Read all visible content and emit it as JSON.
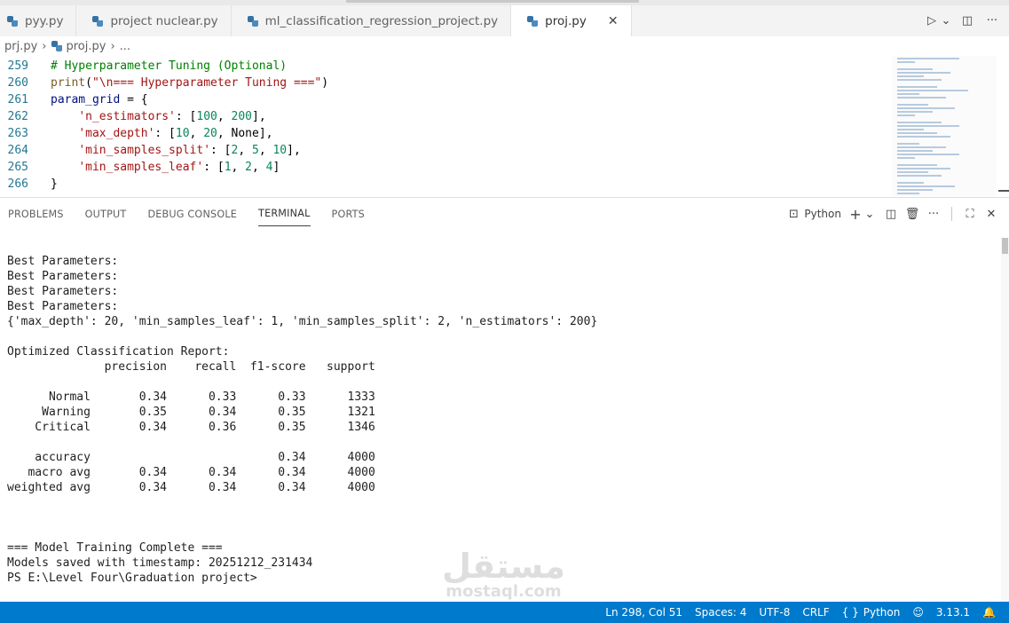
{
  "tabs": [
    {
      "label": "pyy.py",
      "active": false
    },
    {
      "label": "project nuclear.py",
      "active": false
    },
    {
      "label": "ml_classification_regression_project.py",
      "active": false
    },
    {
      "label": "proj.py",
      "active": true
    }
  ],
  "tab_close_glyph": "✕",
  "tab_actions": {
    "run": "▷",
    "run_dropdown": "⌄",
    "split": "◫",
    "more": "···"
  },
  "breadcrumb": {
    "folder": "prj.py",
    "file": "proj.py",
    "more": "..."
  },
  "editor": {
    "lines": [
      {
        "num": "259",
        "tokens": [
          {
            "t": "# Hyperparameter Tuning (Optional)",
            "c": "c-com"
          }
        ]
      },
      {
        "num": "260",
        "tokens": [
          {
            "t": "print",
            "c": "c-fn"
          },
          {
            "t": "(",
            "c": ""
          },
          {
            "t": "\"\\n=== Hyperparameter Tuning ===\"",
            "c": "c-str"
          },
          {
            "t": ")",
            "c": ""
          }
        ]
      },
      {
        "num": "261",
        "tokens": [
          {
            "t": "param_grid",
            "c": "c-var"
          },
          {
            "t": " = {",
            "c": ""
          }
        ]
      },
      {
        "num": "262",
        "tokens": [
          {
            "t": "    ",
            "c": ""
          },
          {
            "t": "'n_estimators'",
            "c": "c-str"
          },
          {
            "t": ": [",
            "c": ""
          },
          {
            "t": "100",
            "c": "c-num"
          },
          {
            "t": ", ",
            "c": ""
          },
          {
            "t": "200",
            "c": "c-num"
          },
          {
            "t": "],",
            "c": ""
          }
        ]
      },
      {
        "num": "263",
        "tokens": [
          {
            "t": "    ",
            "c": ""
          },
          {
            "t": "'max_depth'",
            "c": "c-str"
          },
          {
            "t": ": [",
            "c": ""
          },
          {
            "t": "10",
            "c": "c-num"
          },
          {
            "t": ", ",
            "c": ""
          },
          {
            "t": "20",
            "c": "c-num"
          },
          {
            "t": ", None],",
            "c": ""
          }
        ]
      },
      {
        "num": "264",
        "tokens": [
          {
            "t": "    ",
            "c": ""
          },
          {
            "t": "'min_samples_split'",
            "c": "c-str"
          },
          {
            "t": ": [",
            "c": ""
          },
          {
            "t": "2",
            "c": "c-num"
          },
          {
            "t": ", ",
            "c": ""
          },
          {
            "t": "5",
            "c": "c-num"
          },
          {
            "t": ", ",
            "c": ""
          },
          {
            "t": "10",
            "c": "c-num"
          },
          {
            "t": "],",
            "c": ""
          }
        ]
      },
      {
        "num": "265",
        "tokens": [
          {
            "t": "    ",
            "c": ""
          },
          {
            "t": "'min_samples_leaf'",
            "c": "c-str"
          },
          {
            "t": ": [",
            "c": ""
          },
          {
            "t": "1",
            "c": "c-num"
          },
          {
            "t": ", ",
            "c": ""
          },
          {
            "t": "2",
            "c": "c-num"
          },
          {
            "t": ", ",
            "c": ""
          },
          {
            "t": "4",
            "c": "c-num"
          },
          {
            "t": "]",
            "c": ""
          }
        ]
      },
      {
        "num": "266",
        "tokens": [
          {
            "t": "}",
            "c": ""
          }
        ]
      }
    ]
  },
  "panel": {
    "tabs": [
      {
        "label": "PROBLEMS",
        "active": false
      },
      {
        "label": "OUTPUT",
        "active": false
      },
      {
        "label": "DEBUG CONSOLE",
        "active": false
      },
      {
        "label": "TERMINAL",
        "active": true
      },
      {
        "label": "PORTS",
        "active": false
      }
    ],
    "shell_label": "Python",
    "actions": {
      "shell_icon": "⊡",
      "add": "+",
      "add_dropdown": "⌄",
      "split": "◫",
      "trash": "🗑",
      "more": "···",
      "maximize": "⛶",
      "close": "✕"
    }
  },
  "terminal": {
    "lines": [
      "Best Parameters:",
      "Best Parameters:",
      "Best Parameters:",
      "Best Parameters:",
      "{'max_depth': 20, 'min_samples_leaf': 1, 'min_samples_split': 2, 'n_estimators': 200}",
      "",
      "Optimized Classification Report:",
      "              precision    recall  f1-score   support",
      "",
      "      Normal       0.34      0.33      0.33      1333",
      "     Warning       0.35      0.34      0.35      1321",
      "    Critical       0.34      0.36      0.35      1346",
      "",
      "    accuracy                           0.34      4000",
      "   macro avg       0.34      0.34      0.34      4000",
      "weighted avg       0.34      0.34      0.34      4000",
      "",
      "",
      "",
      "=== Model Training Complete ===",
      "Models saved with timestamp: 20251212_231434",
      "PS E:\\Level Four\\Graduation project>"
    ]
  },
  "watermark": {
    "arabic": "مستقل",
    "latin": "mostaql.com"
  },
  "status": {
    "position": "Ln 298, Col 51",
    "spaces": "Spaces: 4",
    "encoding": "UTF-8",
    "eol": "CRLF",
    "language": "Python",
    "version": "3.13.1",
    "language_icon": "{ }",
    "copilot_icon": "☺",
    "bell_icon": "🔔"
  },
  "colors": {
    "statusbar": "#007acc",
    "tabbar": "#f3f3f3",
    "line_numbers": "#237893"
  }
}
